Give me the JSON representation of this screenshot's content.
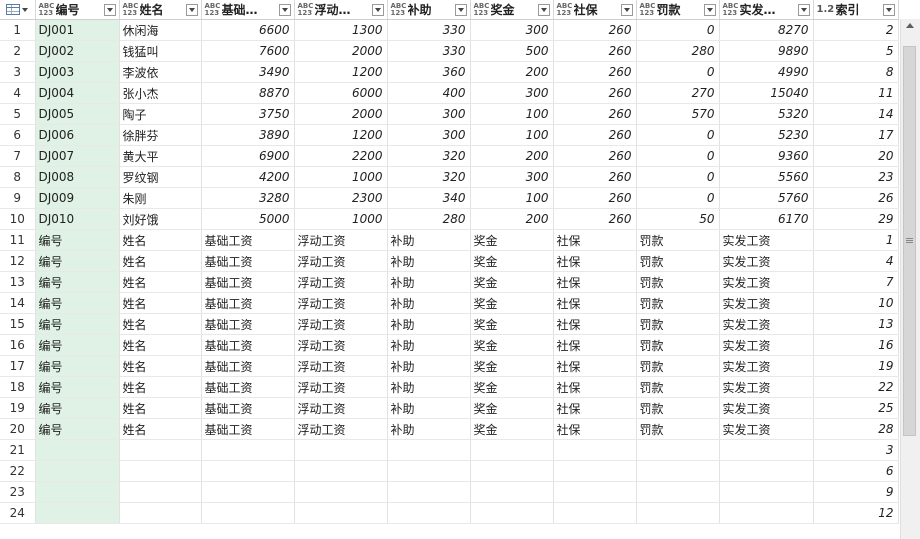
{
  "columns": [
    {
      "type": "ABC\n123",
      "name": "编号",
      "kind": "text"
    },
    {
      "type": "ABC\n123",
      "name": "姓名",
      "kind": "text"
    },
    {
      "type": "ABC\n123",
      "name": "基础…",
      "kind": "num"
    },
    {
      "type": "ABC\n123",
      "name": "浮动…",
      "kind": "num"
    },
    {
      "type": "ABC\n123",
      "name": "补助",
      "kind": "num"
    },
    {
      "type": "ABC\n123",
      "name": "奖金",
      "kind": "num"
    },
    {
      "type": "ABC\n123",
      "name": "社保",
      "kind": "num"
    },
    {
      "type": "ABC\n123",
      "name": "罚款",
      "kind": "num"
    },
    {
      "type": "ABC\n123",
      "name": "实发…",
      "kind": "num"
    },
    {
      "type": "1.2",
      "name": "索引",
      "kind": "num"
    }
  ],
  "rows": [
    [
      "1",
      "DJ001",
      "休闲海",
      "6600",
      "1300",
      "330",
      "300",
      "260",
      "0",
      "8270",
      "2"
    ],
    [
      "2",
      "DJ002",
      "钱猛叫",
      "7600",
      "2000",
      "330",
      "500",
      "260",
      "280",
      "9890",
      "5"
    ],
    [
      "3",
      "DJ003",
      "李波依",
      "3490",
      "1200",
      "360",
      "200",
      "260",
      "0",
      "4990",
      "8"
    ],
    [
      "4",
      "DJ004",
      "张小杰",
      "8870",
      "6000",
      "400",
      "300",
      "260",
      "270",
      "15040",
      "11"
    ],
    [
      "5",
      "DJ005",
      "陶子",
      "3750",
      "2000",
      "300",
      "100",
      "260",
      "570",
      "5320",
      "14"
    ],
    [
      "6",
      "DJ006",
      "徐胖芬",
      "3890",
      "1200",
      "300",
      "100",
      "260",
      "0",
      "5230",
      "17"
    ],
    [
      "7",
      "DJ007",
      "黄大平",
      "6900",
      "2200",
      "320",
      "200",
      "260",
      "0",
      "9360",
      "20"
    ],
    [
      "8",
      "DJ008",
      "罗纹钢",
      "4200",
      "1000",
      "320",
      "300",
      "260",
      "0",
      "5560",
      "23"
    ],
    [
      "9",
      "DJ009",
      "朱刚",
      "3280",
      "2300",
      "340",
      "100",
      "260",
      "0",
      "5760",
      "26"
    ],
    [
      "10",
      "DJ010",
      "刘好饿",
      "5000",
      "1000",
      "280",
      "200",
      "260",
      "50",
      "6170",
      "29"
    ],
    [
      "11",
      "编号",
      "姓名",
      "基础工资",
      "浮动工资",
      "补助",
      "奖金",
      "社保",
      "罚款",
      "实发工资",
      "1"
    ],
    [
      "12",
      "编号",
      "姓名",
      "基础工资",
      "浮动工资",
      "补助",
      "奖金",
      "社保",
      "罚款",
      "实发工资",
      "4"
    ],
    [
      "13",
      "编号",
      "姓名",
      "基础工资",
      "浮动工资",
      "补助",
      "奖金",
      "社保",
      "罚款",
      "实发工资",
      "7"
    ],
    [
      "14",
      "编号",
      "姓名",
      "基础工资",
      "浮动工资",
      "补助",
      "奖金",
      "社保",
      "罚款",
      "实发工资",
      "10"
    ],
    [
      "15",
      "编号",
      "姓名",
      "基础工资",
      "浮动工资",
      "补助",
      "奖金",
      "社保",
      "罚款",
      "实发工资",
      "13"
    ],
    [
      "16",
      "编号",
      "姓名",
      "基础工资",
      "浮动工资",
      "补助",
      "奖金",
      "社保",
      "罚款",
      "实发工资",
      "16"
    ],
    [
      "17",
      "编号",
      "姓名",
      "基础工资",
      "浮动工资",
      "补助",
      "奖金",
      "社保",
      "罚款",
      "实发工资",
      "19"
    ],
    [
      "18",
      "编号",
      "姓名",
      "基础工资",
      "浮动工资",
      "补助",
      "奖金",
      "社保",
      "罚款",
      "实发工资",
      "22"
    ],
    [
      "19",
      "编号",
      "姓名",
      "基础工资",
      "浮动工资",
      "补助",
      "奖金",
      "社保",
      "罚款",
      "实发工资",
      "25"
    ],
    [
      "20",
      "编号",
      "姓名",
      "基础工资",
      "浮动工资",
      "补助",
      "奖金",
      "社保",
      "罚款",
      "实发工资",
      "28"
    ],
    [
      "21",
      "",
      "",
      "",
      "",
      "",
      "",
      "",
      "",
      "",
      "3"
    ],
    [
      "22",
      "",
      "",
      "",
      "",
      "",
      "",
      "",
      "",
      "",
      "6"
    ],
    [
      "23",
      "",
      "",
      "",
      "",
      "",
      "",
      "",
      "",
      "",
      "9"
    ],
    [
      "24",
      "",
      "",
      "",
      "",
      "",
      "",
      "",
      "",
      "",
      "12"
    ]
  ],
  "icons": {
    "corner": "table-icon",
    "filter": "dropdown-icon"
  },
  "colors": {
    "selected_column": "#dff2e5",
    "grid_line": "#e2e2e2"
  }
}
